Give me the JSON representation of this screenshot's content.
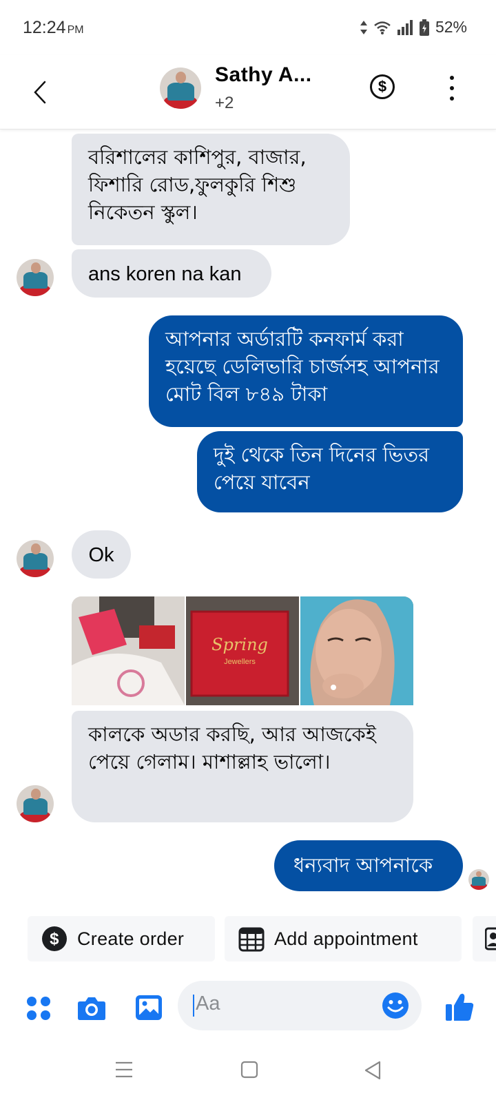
{
  "status_bar": {
    "time": "12:24",
    "ampm": "PM",
    "battery": "52%"
  },
  "header": {
    "contact_name": "Sathy A...",
    "subtitle": "+2"
  },
  "messages": [
    {
      "text": "বরিশালের কাশিপুর, বাজার, ফিশারি রোড,ফুলকুরি শিশু নিকেতন স্কুল।",
      "direction": "incoming"
    },
    {
      "text": "ans koren na kan",
      "direction": "incoming"
    },
    {
      "text": "আপনার অর্ডারটি কনফার্ম করা হয়েছে ডেলিভারি চার্জসহ আপনার মোট বিল ৮৪৯ টাকা",
      "direction": "outgoing"
    },
    {
      "text": "দুই থেকে তিন দিনের ভিতর পেয়ে যাবেন",
      "direction": "outgoing"
    },
    {
      "text": "Ok",
      "direction": "incoming"
    },
    {
      "text": "কালকে অডার করছি, আর আজকেই পেয়ে গেলাম। মাশাল্লাহ ভালো।",
      "direction": "incoming"
    },
    {
      "text": "ধন্যবাদ আপনাকে",
      "direction": "outgoing"
    }
  ],
  "photo_box_text": {
    "brand": "Spring",
    "sub": "Jewellers"
  },
  "quick_actions": [
    {
      "label": "Create order",
      "icon": "dollar-circle-icon"
    },
    {
      "label": "Add appointment",
      "icon": "calendar-icon"
    }
  ],
  "composer": {
    "placeholder": "Aa"
  },
  "colors": {
    "outgoing_bubble": "#0450a3",
    "incoming_bubble": "#e4e6eb",
    "accent": "#1877f2"
  }
}
